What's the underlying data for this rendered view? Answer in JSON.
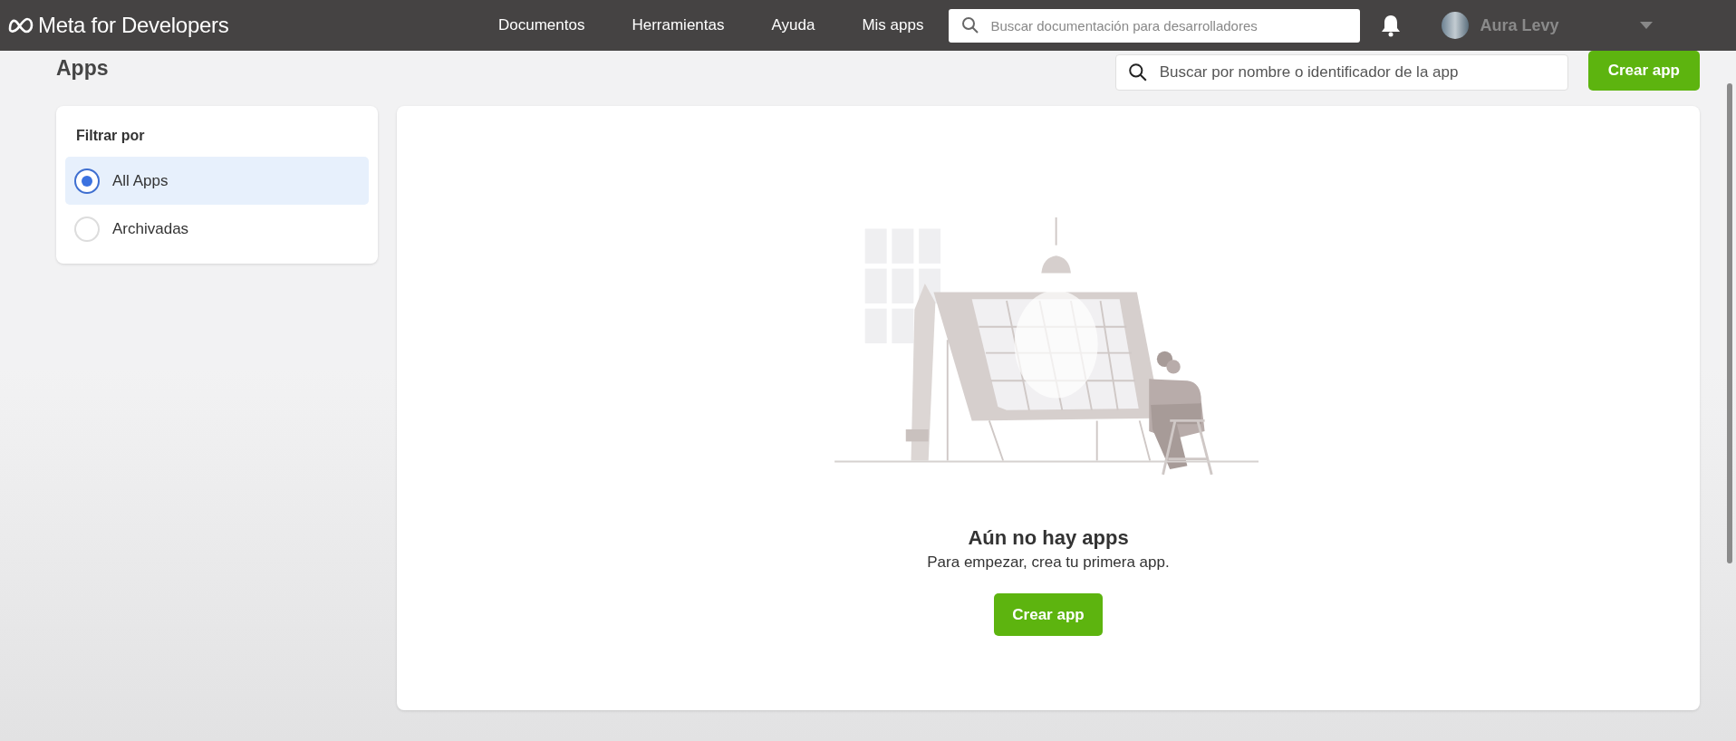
{
  "header": {
    "logo": "Meta for Developers",
    "nav": [
      "Documentos",
      "Herramientas",
      "Ayuda",
      "Mis apps"
    ],
    "search": {
      "placeholder": "Buscar documentación para desarrolladores"
    },
    "user": {
      "name": "Aura Levy"
    }
  },
  "page": {
    "title": "Apps",
    "search": {
      "placeholder": "Buscar por nombre o identificador de la app"
    },
    "create_button": "Crear app"
  },
  "filter": {
    "title": "Filtrar por",
    "options": [
      {
        "label": "All Apps",
        "selected": true
      },
      {
        "label": "Archivadas",
        "selected": false
      }
    ]
  },
  "empty_state": {
    "title": "Aún no hay apps",
    "subtitle": "Para empezar, crea tu primera app.",
    "button": "Crear app"
  }
}
